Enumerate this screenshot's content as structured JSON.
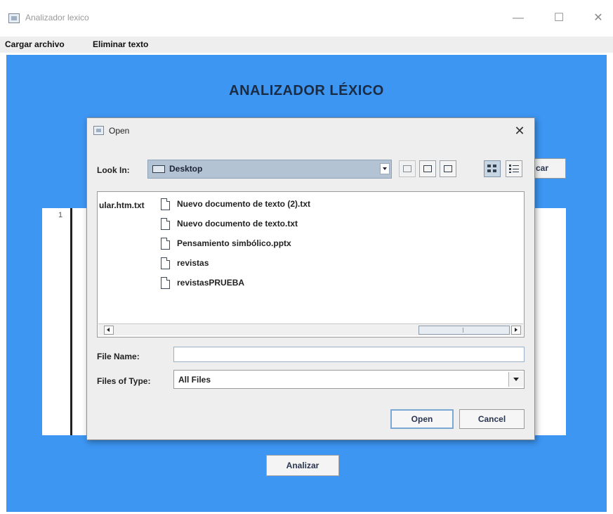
{
  "window": {
    "title": "Analizador lexico",
    "controls": {
      "minimize": "—",
      "maximize": "☐",
      "close": "✕"
    }
  },
  "menubar": {
    "items": [
      "Cargar archivo",
      "Eliminar texto"
    ]
  },
  "main": {
    "heading": "ANALIZADOR LÉXICO",
    "line_number": "1",
    "background_button_partial": "car",
    "analyze_button": "Analizar",
    "background_color": "#3d96f2"
  },
  "dialog": {
    "title": "Open",
    "close": "✕",
    "look_in_label": "Look In:",
    "look_in_value": "Desktop",
    "toolbar": [
      "up-folder-icon",
      "home-icon",
      "new-folder-icon",
      "list-view-icon",
      "details-view-icon"
    ],
    "truncated_file": "ular.htm.txt",
    "files": [
      "Nuevo documento de texto (2).txt",
      "Nuevo documento de texto.txt",
      "Pensamiento simbólico.pptx",
      "revistas",
      "revistasPRUEBA"
    ],
    "file_name_label": "File Name:",
    "file_name_value": "",
    "files_of_type_label": "Files of Type:",
    "files_of_type_value": "All Files",
    "open_button": "Open",
    "cancel_button": "Cancel"
  }
}
